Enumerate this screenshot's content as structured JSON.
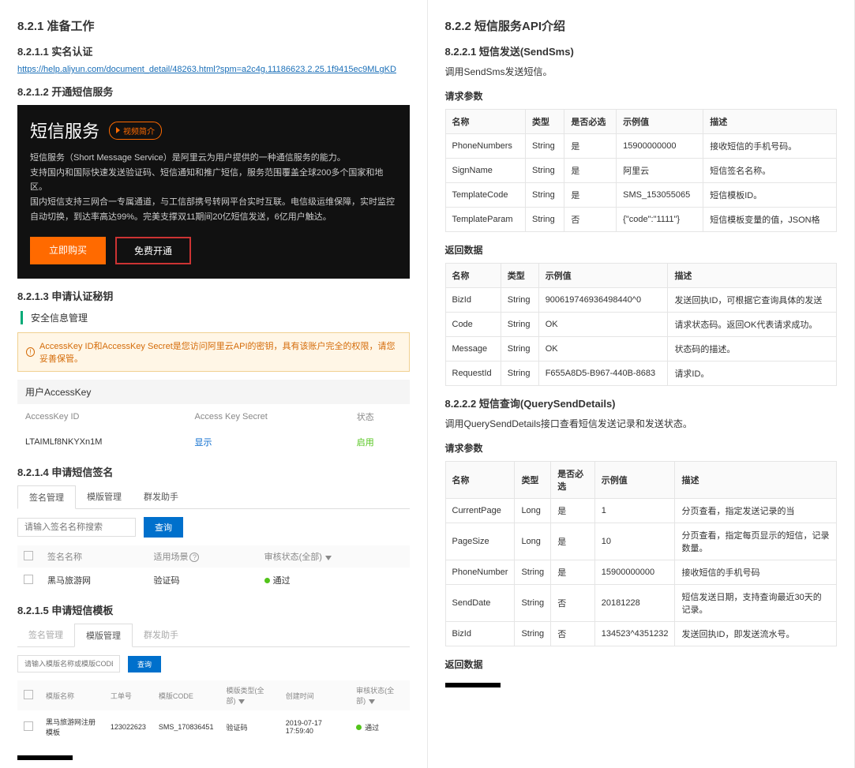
{
  "left": {
    "h_821": "8.2.1 准备工作",
    "h_8211": "8.2.1.1 实名认证",
    "link_8211": "https://help.aliyun.com/document_detail/48263.html?spm=a2c4g.11186623.2.25.1f9415ec9MLgKD",
    "h_8212": "8.2.1.2 开通短信服务",
    "banner_title": "短信服务",
    "banner_play": "视频简介",
    "banner_desc_l1": "短信服务（Short Message Service）是阿里云为用户提供的一种通信服务的能力。",
    "banner_desc_l2": "支持国内和国际快速发送验证码、短信通知和推广短信，服务范围覆盖全球200多个国家和地区。",
    "banner_desc_l3": "国内短信支持三网合一专属通道，与工信部携号转网平台实时互联。电信级运维保障，实时监控自动切换，到达率高达99%。完美支撑双11期间20亿短信发送，6亿用户触达。",
    "btn_buy": "立即购买",
    "btn_free": "免费开通",
    "h_8213": "8.2.1.3 申请认证秘钥",
    "sec_mgmt": "安全信息管理",
    "warn_text": "AccessKey ID和AccessKey Secret是您访问阿里云API的密钥，具有该账户完全的权限，请您妥善保管。",
    "ak_header": "用户AccessKey",
    "ak_cols": {
      "id": "AccessKey ID",
      "secret": "Access Key Secret",
      "status": "状态"
    },
    "ak_row": {
      "id": "LTAIMLf8NKYXn1M",
      "secret": "显示",
      "status": "启用"
    },
    "h_8214": "8.2.1.4 申请短信签名",
    "tabs_sig": [
      "签名管理",
      "模版管理",
      "群发助手"
    ],
    "sig_search_ph": "请输入签名名称搜索",
    "sig_search_btn": "查询",
    "sig_cols": {
      "name": "签名名称",
      "scene": "适用场景",
      "status": "审核状态(全部)"
    },
    "sig_row": {
      "name": "黑马旅游网",
      "scene": "验证码",
      "status": "通过"
    },
    "h_8215": "8.2.1.5 申请短信模板",
    "tabs_tpl": [
      "签名管理",
      "模版管理",
      "群发助手"
    ],
    "tpl_search_ph": "请输入模版名称或模版CODE搜索",
    "tpl_search_btn": "查询",
    "tpl_cols": {
      "name": "模版名称",
      "ticket": "工单号",
      "code": "模版CODE",
      "type": "模版类型(全部)",
      "time": "创建时间",
      "status": "审核状态(全部)"
    },
    "tpl_row": {
      "name": "黑马旅游网注册模板",
      "ticket": "123022623",
      "code": "SMS_170836451",
      "type": "验证码",
      "time": "2019-07-17 17:59:40",
      "status": "通过"
    }
  },
  "right": {
    "h_822": "8.2.2 短信服务API介绍",
    "h_8221": "8.2.2.1 短信发送(SendSms)",
    "desc_8221": "调用SendSms发送短信。",
    "req_params_label": "请求参数",
    "ret_data_label": "返回数据",
    "api1_req_cols": [
      "名称",
      "类型",
      "是否必选",
      "示例值",
      "描述"
    ],
    "api1_req_rows": [
      {
        "name": "PhoneNumbers",
        "type": "String",
        "required": "是",
        "example": "15900000000",
        "desc": "接收短信的手机号码。"
      },
      {
        "name": "SignName",
        "type": "String",
        "required": "是",
        "example": "阿里云",
        "desc": "短信签名名称。"
      },
      {
        "name": "TemplateCode",
        "type": "String",
        "required": "是",
        "example": "SMS_153055065",
        "desc": "短信模板ID。"
      },
      {
        "name": "TemplateParam",
        "type": "String",
        "required": "否",
        "example": "{\"code\":\"1111\"}",
        "desc": "短信模板变量的值，JSON格"
      }
    ],
    "api1_ret_cols": [
      "名称",
      "类型",
      "示例值",
      "描述"
    ],
    "api1_ret_rows": [
      {
        "name": "BizId",
        "type": "String",
        "example": "900619746936498440^0",
        "desc": "发送回执ID，可根据它查询具体的发送"
      },
      {
        "name": "Code",
        "type": "String",
        "example": "OK",
        "desc": "请求状态码。返回OK代表请求成功。"
      },
      {
        "name": "Message",
        "type": "String",
        "example": "OK",
        "desc": "状态码的描述。"
      },
      {
        "name": "RequestId",
        "type": "String",
        "example": "F655A8D5-B967-440B-8683",
        "desc": "请求ID。"
      }
    ],
    "h_8222": "8.2.2.2 短信查询(QuerySendDetails)",
    "desc_8222": "调用QuerySendDetails接口查看短信发送记录和发送状态。",
    "api2_req_cols": [
      "名称",
      "类型",
      "是否必选",
      "示例值",
      "描述"
    ],
    "api2_req_rows": [
      {
        "name": "CurrentPage",
        "type": "Long",
        "required": "是",
        "example": "1",
        "desc": "分页查看，指定发送记录的当"
      },
      {
        "name": "PageSize",
        "type": "Long",
        "required": "是",
        "example": "10",
        "desc": "分页查看，指定每页显示的短信，记录数量。"
      },
      {
        "name": "PhoneNumber",
        "type": "String",
        "required": "是",
        "example": "15900000000",
        "desc": "接收短信的手机号码"
      },
      {
        "name": "SendDate",
        "type": "String",
        "required": "否",
        "example": "20181228",
        "desc": "短信发送日期，支持查询最近30天的记录。"
      },
      {
        "name": "BizId",
        "type": "String",
        "required": "否",
        "example": "134523^4351232",
        "desc": "发送回执ID，即发送流水号。"
      }
    ]
  }
}
